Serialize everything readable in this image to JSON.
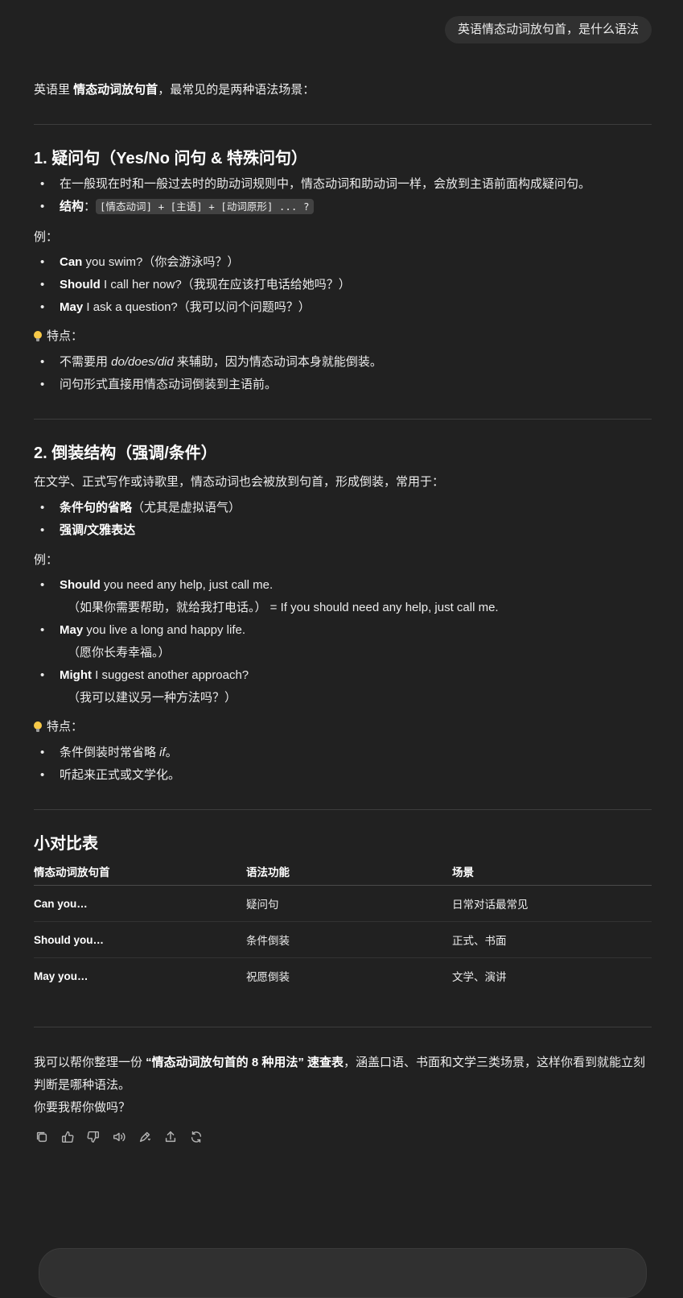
{
  "user_message": "英语情态动词放句首，是什么语法",
  "intro": {
    "pre": "英语里 ",
    "bold": "情态动词放句首",
    "post": "，最常见的是两种语法场景："
  },
  "section1": {
    "title": "1. 疑问句（Yes/No 问句 & 特殊问句）",
    "bullets": [
      {
        "text": "在一般现在时和一般过去时的助动词规则中，情态动词和助动词一样，会放到主语前面构成疑问句。"
      },
      {
        "label": "结构",
        "sep": "：",
        "code": "[情态动词] + [主语] + [动词原形] ... ?"
      }
    ],
    "example_label": "例：",
    "examples": [
      {
        "bold": "Can",
        "rest": " you swim?（你会游泳吗？）"
      },
      {
        "bold": "Should",
        "rest": " I call her now?（我现在应该打电话给她吗？）"
      },
      {
        "bold": "May",
        "rest": " I ask a question?（我可以问个问题吗？）"
      }
    ],
    "feature_label": "特点：",
    "features": [
      {
        "pre": "不需要用 ",
        "italic": "do/does/did",
        "post": " 来辅助，因为情态动词本身就能倒装。"
      },
      {
        "pre": "问句形式直接用情态动词倒装到主语前。",
        "italic": "",
        "post": ""
      }
    ]
  },
  "section2": {
    "title": "2. 倒装结构（强调/条件）",
    "intro": "在文学、正式写作或诗歌里，情态动词也会被放到句首，形成倒装，常用于：",
    "uses": [
      {
        "bold": "条件句的省略",
        "rest": "（尤其是虚拟语气）"
      },
      {
        "bold": "强调/文雅表达",
        "rest": ""
      }
    ],
    "example_label": "例：",
    "examples": [
      {
        "bold": "Should",
        "rest": " you need any help, just call me.",
        "sub": "（如果你需要帮助，就给我打电话。） = If you should need any help, just call me."
      },
      {
        "bold": "May",
        "rest": " you live a long and happy life.",
        "sub": "（愿你长寿幸福。）"
      },
      {
        "bold": "Might",
        "rest": " I suggest another approach?",
        "sub": "（我可以建议另一种方法吗？）"
      }
    ],
    "feature_label": "特点：",
    "features": [
      {
        "pre": "条件倒装时常省略 ",
        "italic": "if",
        "post": "。"
      },
      {
        "pre": "听起来正式或文学化。",
        "italic": "",
        "post": ""
      }
    ]
  },
  "table": {
    "title": "小对比表",
    "headers": [
      "情态动词放句首",
      "语法功能",
      "场景"
    ],
    "rows": [
      [
        "Can you…",
        "疑问句",
        "日常对话最常见"
      ],
      [
        "Should you…",
        "条件倒装",
        "正式、书面"
      ],
      [
        "May you…",
        "祝愿倒装",
        "文学、演讲"
      ]
    ]
  },
  "closing": {
    "pre": "我可以帮你整理一份 ",
    "bold": "“情态动词放句首的 8 种用法” 速查表",
    "post": "，涵盖口语、书面和文学三类场景，这样你看到就能立刻判断是哪种语法。",
    "question": "你要我帮你做吗？"
  },
  "actions": [
    "copy-icon",
    "thumbs-up-icon",
    "thumbs-down-icon",
    "read-aloud-icon",
    "edit-icon",
    "share-icon",
    "regenerate-icon"
  ]
}
